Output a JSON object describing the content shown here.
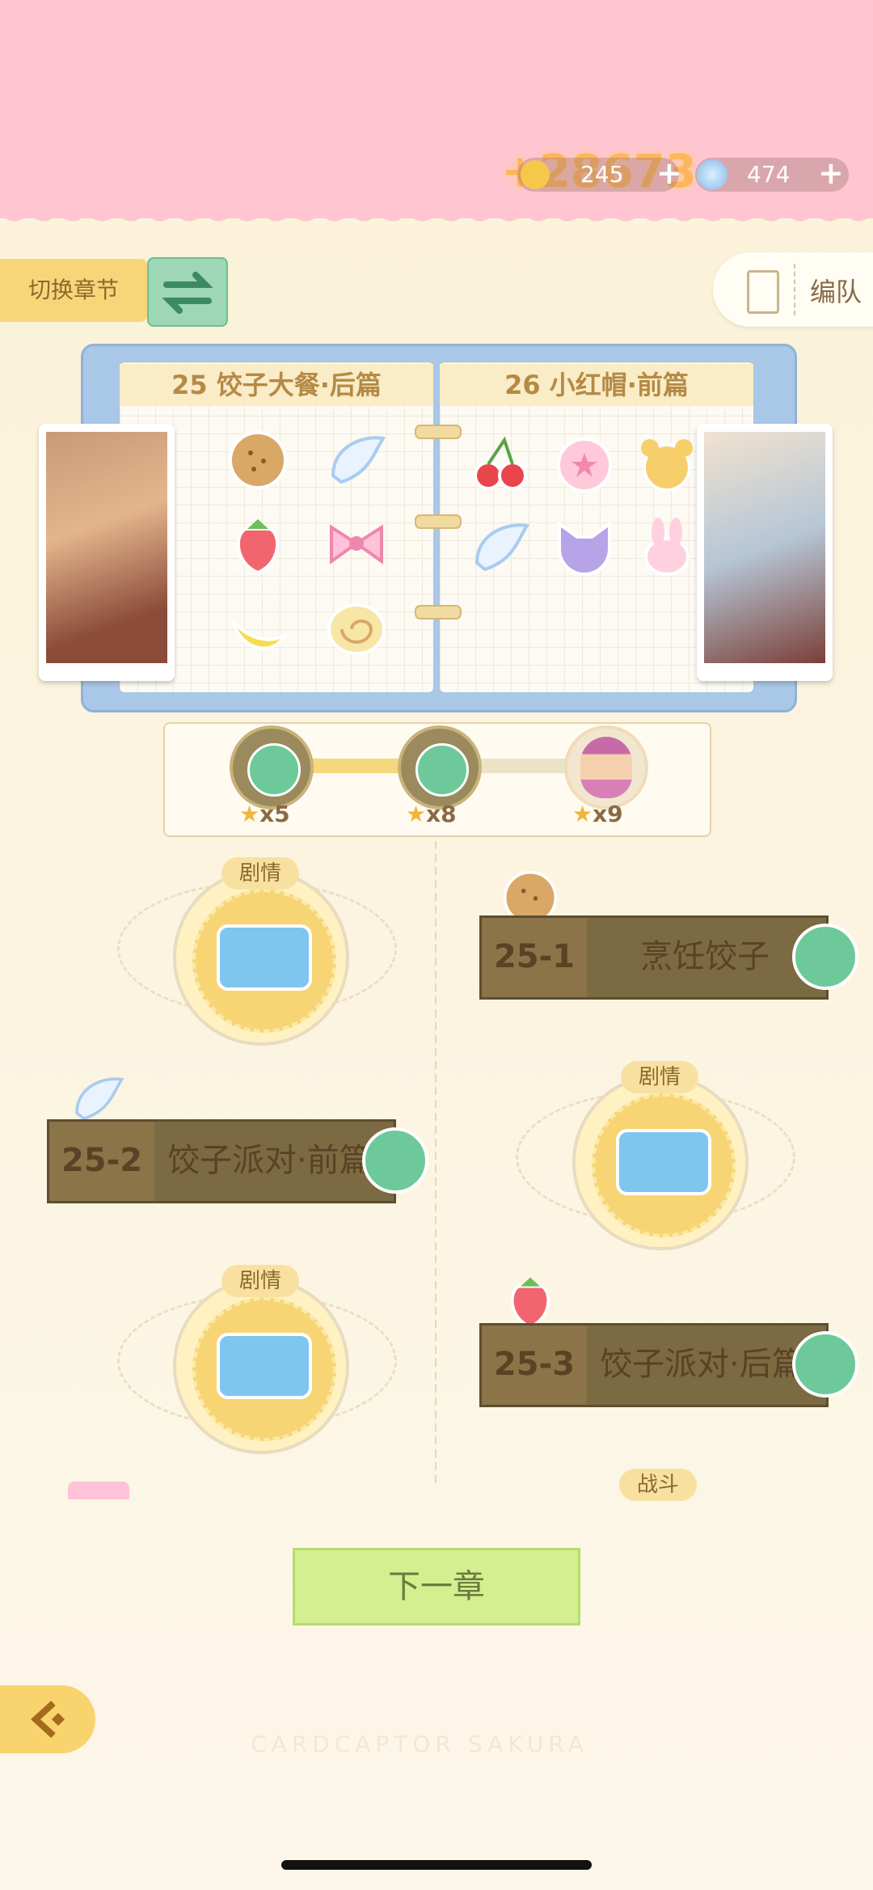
{
  "currency": {
    "coin_value": "245",
    "coin_float": "+28673",
    "gem_value": "474",
    "plus": "+"
  },
  "toolbar": {
    "switch_chapter_label": "切换章节",
    "team_label": "编队"
  },
  "book": {
    "left_title": "25 饺子大餐·后篇",
    "right_title": "26 小红帽·前篇"
  },
  "progress": {
    "milestones": [
      {
        "stars": "x5",
        "claimed": true
      },
      {
        "stars": "x8",
        "claimed": true
      },
      {
        "stars": "x9",
        "claimed": false
      }
    ],
    "fill_fraction": 0.56
  },
  "stages": [
    {
      "tag": "剧情",
      "type": "story"
    },
    {
      "num": "25-1",
      "name": "烹饪饺子",
      "cleared": true,
      "icon": "cookie-icon"
    },
    {
      "num": "25-2",
      "name": "饺子派对·前篇",
      "cleared": true,
      "icon": "wing-icon"
    },
    {
      "tag": "剧情",
      "type": "story"
    },
    {
      "tag": "剧情",
      "type": "story"
    },
    {
      "num": "25-3",
      "name": "饺子派对·后篇",
      "cleared": true,
      "icon": "strawberry-icon"
    },
    {
      "tag": "战斗",
      "type": "battle"
    }
  ],
  "footer": {
    "next_chapter_label": "下一章",
    "watermark": "CARDCAPTOR SAKURA"
  },
  "colors": {
    "top_band": "#ffc5d0",
    "check_green": "#6dc99a",
    "stage_bar": "#7b6a42",
    "next_button": "#d3ef90"
  }
}
